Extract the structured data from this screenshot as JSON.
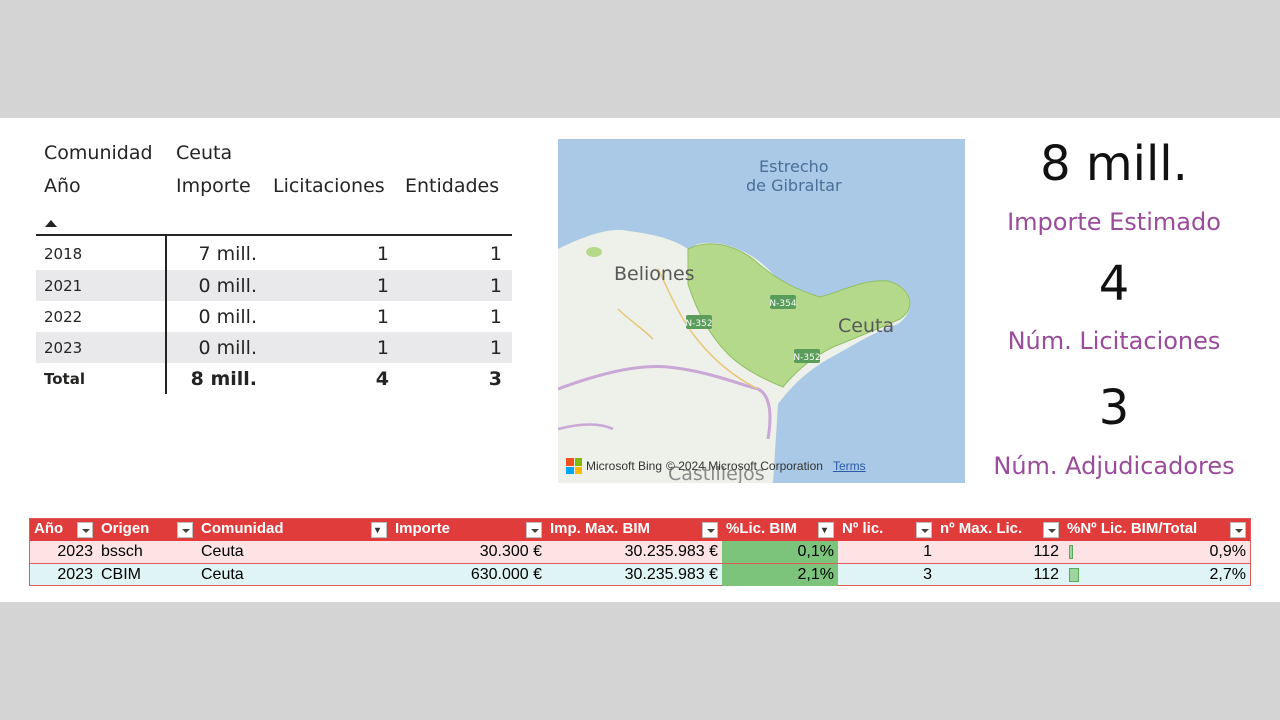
{
  "pivot": {
    "filter_label": "Comunidad",
    "filter_value": "Ceuta",
    "columns": [
      "Año",
      "Importe",
      "Licitaciones",
      "Entidades"
    ],
    "rows": [
      {
        "year": "2018",
        "importe": "7 mill.",
        "licitaciones": "1",
        "entidades": "1"
      },
      {
        "year": "2021",
        "importe": "0 mill.",
        "licitaciones": "1",
        "entidades": "1"
      },
      {
        "year": "2022",
        "importe": "0 mill.",
        "licitaciones": "1",
        "entidades": "1"
      },
      {
        "year": "2023",
        "importe": "0 mill.",
        "licitaciones": "1",
        "entidades": "1"
      }
    ],
    "total": {
      "label": "Total",
      "importe": "8 mill.",
      "licitaciones": "4",
      "entidades": "3"
    }
  },
  "map": {
    "strait_label_1": "Estrecho",
    "strait_label_2": "de Gibraltar",
    "city_1": "Beliones",
    "city_2": "Ceuta",
    "city_3": "Castillejos",
    "provider": "Microsoft Bing",
    "copyright": "© 2024 Microsoft Corporation",
    "terms": "Terms",
    "road_labels": [
      "N-352",
      "N-354",
      "N-352"
    ],
    "colors": {
      "water": "#aac9e6",
      "land": "#eef1ea",
      "highlight": "#b5d98a"
    }
  },
  "kpis": [
    {
      "value": "8 mill.",
      "label": "Importe Estimado"
    },
    {
      "value": "4",
      "label": "Núm. Licitaciones"
    },
    {
      "value": "3",
      "label": "Núm. Adjudicadores"
    }
  ],
  "excel": {
    "headers": [
      "Año",
      "Origen",
      "Comunidad",
      "Importe",
      "Imp. Max. BIM",
      "%Lic. BIM",
      "Nº lic.",
      "nº Max. Lic.",
      "%Nº Lic. BIM/Total"
    ],
    "rows": [
      {
        "year": "2023",
        "origen": "bssch",
        "comunidad": "Ceuta",
        "importe": "30.300 €",
        "max_bim": "30.235.983 €",
        "pct_bim": "0,1%",
        "n_lic": "1",
        "max_lic": "112",
        "pct_total": "0,9%"
      },
      {
        "year": "2023",
        "origen": "CBIM",
        "comunidad": "Ceuta",
        "importe": "630.000 €",
        "max_bim": "30.235.983 €",
        "pct_bim": "2,1%",
        "n_lic": "3",
        "max_lic": "112",
        "pct_total": "2,7%"
      }
    ],
    "colors": {
      "header": "#e03c3c",
      "row1": "#fde3e3",
      "row2": "#dff5f5",
      "highlight": "#7cc47c"
    }
  }
}
